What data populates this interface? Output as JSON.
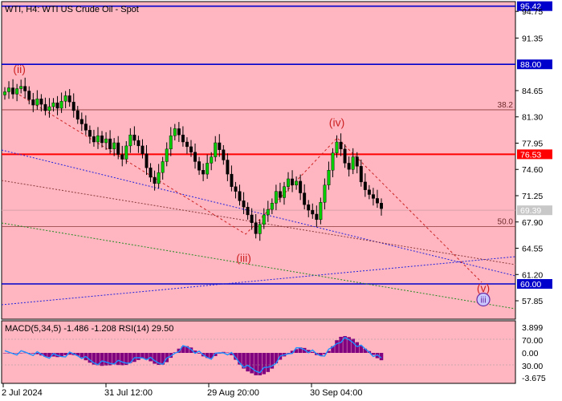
{
  "header": {
    "title": "WTI, H4:  WTI US Crude Oil - Spot",
    "indicator_label": "MACD(5,34,5) -1.486 -1.208 RSI(14) 29.50"
  },
  "colors": {
    "chart_bg": "#ffb6c1",
    "panel_border": "#000000",
    "bull": "#00cc00",
    "bear": "#000000",
    "level_blue": "#0000cc",
    "level_red": "#ff0000",
    "fib": "#8b3a3a",
    "wave": "#cc2222",
    "macd_hist": "#800080",
    "macd_signal": "#1e90ff",
    "price_tag_blue": "#0000cc",
    "price_tag_red": "#ff0000",
    "price_tag_gray": "#c8c8c8"
  },
  "chart_data": {
    "type": "candlestick",
    "title": "WTI, H4:  WTI US Crude Oil - Spot",
    "y_axis": {
      "ticks": [
        "95.42",
        "94.75",
        "91.35",
        "88.00",
        "84.65",
        "81.30",
        "77.95",
        "76.53",
        "74.60",
        "71.25",
        "69.39",
        "67.90",
        "64.55",
        "61.20",
        "60.00",
        "57.85"
      ],
      "range": [
        55.5,
        96.0
      ]
    },
    "x_axis": {
      "ticks": [
        "2 Jul 2024",
        "31 Jul 12:00",
        "29 Aug 20:00",
        "30 Sep 04:00"
      ]
    },
    "levels": [
      {
        "value": 95.42,
        "label": "95.42",
        "color": "#0000cc",
        "kind": "horizontal"
      },
      {
        "value": 88.0,
        "label": "88.00",
        "color": "#0000cc",
        "kind": "horizontal"
      },
      {
        "value": 82.2,
        "label": "38.2",
        "color": "#8b3a3a",
        "kind": "fib"
      },
      {
        "value": 76.53,
        "label": "76.53",
        "color": "#ff0000",
        "kind": "horizontal"
      },
      {
        "value": 67.3,
        "label": "50.0",
        "color": "#8b3a3a",
        "kind": "fib"
      },
      {
        "value": 69.39,
        "label": "69.39",
        "color": "#c8c8c8",
        "kind": "current"
      },
      {
        "value": 60.0,
        "label": "60.00",
        "color": "#0000cc",
        "kind": "horizontal"
      }
    ],
    "wave_labels": [
      {
        "label": "(ii)",
        "i": 2,
        "value": 86.9
      },
      {
        "label": "(iii)",
        "i": 59,
        "value": 62.8
      },
      {
        "label": "(iv)",
        "i": 82,
        "value": 80.1
      },
      {
        "label": "(v)",
        "i": 116,
        "value": 59.0
      },
      {
        "label": "iii",
        "i": 116,
        "value": 57.6
      }
    ],
    "closes": [
      84.5,
      85.0,
      84.2,
      84.9,
      85.2,
      84.6,
      83.5,
      82.8,
      83.6,
      82.9,
      82.1,
      82.6,
      83.1,
      82.4,
      83.3,
      84.0,
      83.2,
      82.1,
      81.0,
      80.4,
      79.6,
      78.8,
      78.1,
      78.9,
      78.0,
      78.5,
      77.2,
      78.0,
      76.5,
      75.9,
      77.6,
      79.0,
      78.3,
      77.6,
      76.6,
      74.8,
      73.6,
      72.8,
      74.2,
      75.6,
      77.2,
      78.9,
      79.8,
      79.0,
      78.1,
      77.5,
      76.8,
      75.6,
      74.5,
      74.0,
      75.4,
      76.2,
      78.0,
      77.1,
      75.8,
      74.0,
      72.4,
      71.8,
      70.6,
      69.8,
      68.8,
      67.8,
      66.4,
      67.6,
      68.8,
      69.5,
      70.3,
      71.8,
      71.0,
      72.4,
      73.4,
      72.6,
      73.1,
      71.6,
      70.1,
      69.4,
      68.9,
      68.2,
      70.4,
      72.6,
      74.5,
      76.7,
      78.1,
      77.2,
      75.4,
      74.6,
      76.2,
      75.0,
      73.0,
      72.0,
      71.4,
      70.9,
      70.3,
      69.6
    ]
  }
}
